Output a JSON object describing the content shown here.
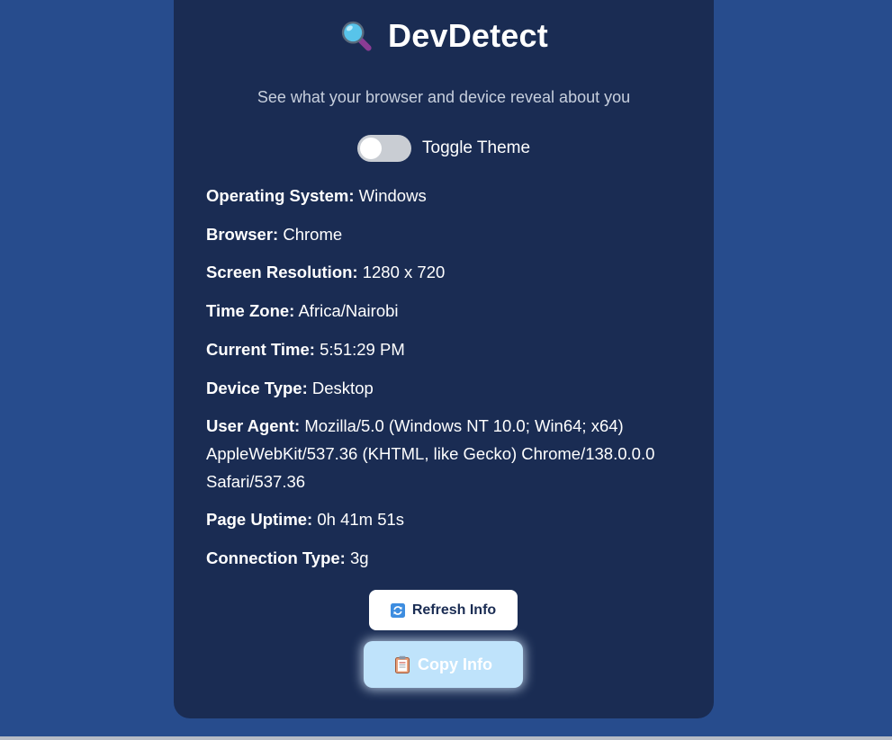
{
  "app": {
    "title": "DevDetect",
    "subtitle": "See what your browser and device reveal about you",
    "title_icon": "magnifying-glass-icon"
  },
  "theme_toggle": {
    "label": "Toggle Theme",
    "checked": false
  },
  "info": {
    "os": {
      "label": "Operating System:",
      "value": "Windows"
    },
    "browser": {
      "label": "Browser:",
      "value": "Chrome"
    },
    "resolution": {
      "label": "Screen Resolution:",
      "value": "1280 x 720"
    },
    "timezone": {
      "label": "Time Zone:",
      "value": "Africa/Nairobi"
    },
    "current_time": {
      "label": "Current Time:",
      "value": "5:51:29 PM"
    },
    "device_type": {
      "label": "Device Type:",
      "value": "Desktop"
    },
    "user_agent": {
      "label": "User Agent:",
      "value": "Mozilla/5.0 (Windows NT 10.0; Win64; x64) AppleWebKit/537.36 (KHTML, like Gecko) Chrome/138.0.0.0 Safari/537.36"
    },
    "uptime": {
      "label": "Page Uptime:",
      "value": "0h 41m 51s"
    },
    "connection": {
      "label": "Connection Type:",
      "value": "3g"
    }
  },
  "buttons": {
    "refresh": {
      "label": "Refresh Info",
      "icon": "refresh-icon"
    },
    "copy": {
      "label": "Copy Info",
      "icon": "clipboard-icon"
    }
  },
  "colors": {
    "background": "#274c8d",
    "card": "#1a2c53",
    "copy_button": "#bfe3fb",
    "refresh_button": "#ffffff"
  }
}
